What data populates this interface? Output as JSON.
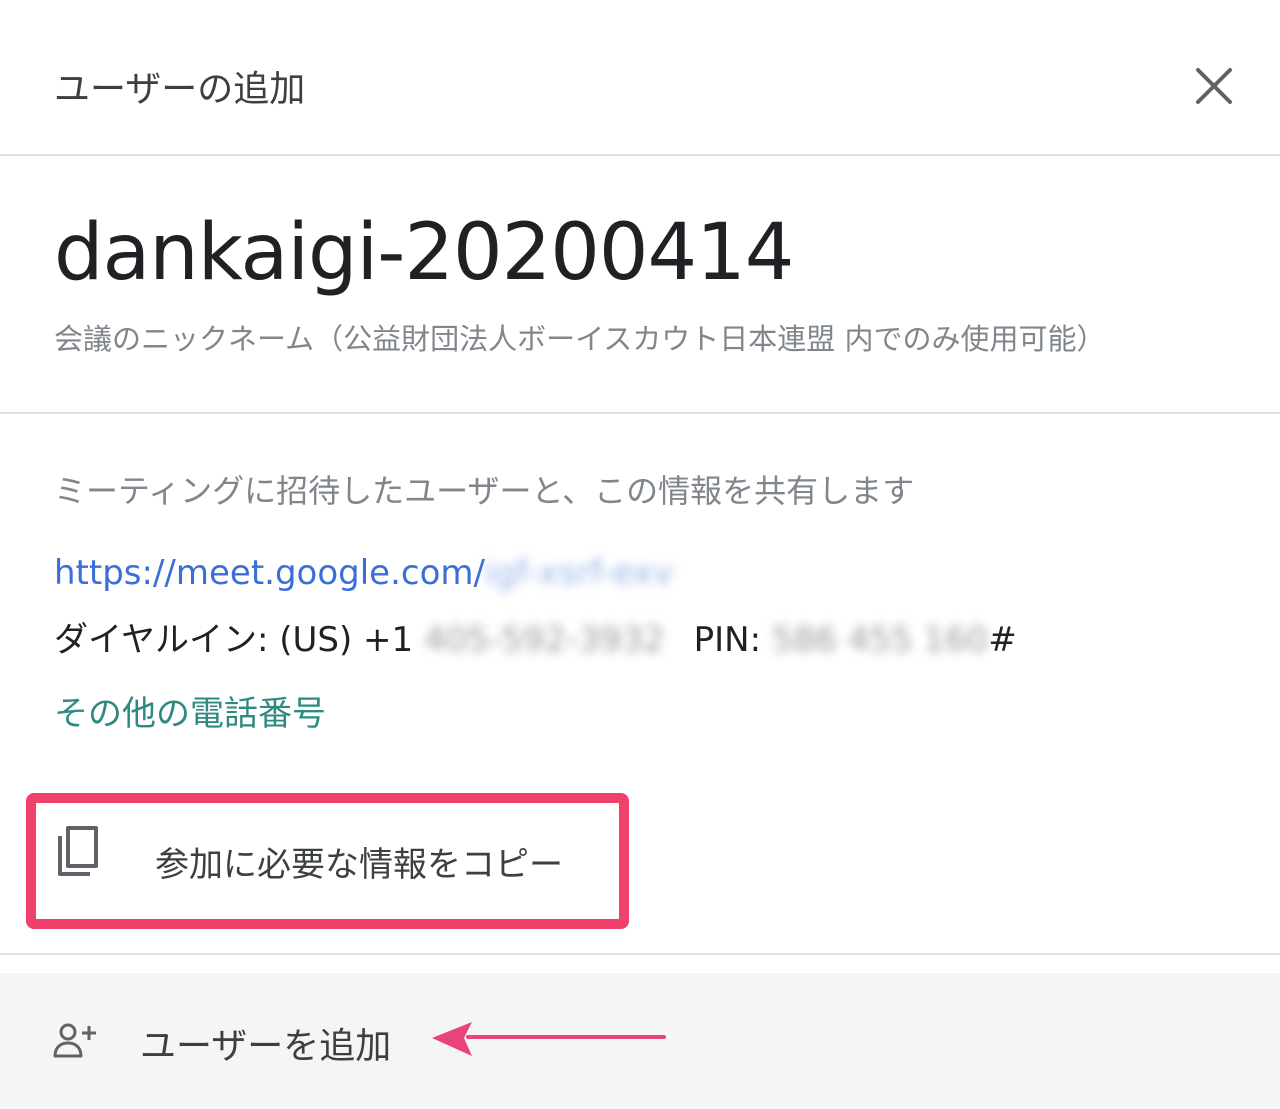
{
  "dialog": {
    "title": "ユーザーの追加",
    "close_icon": "close-icon"
  },
  "meeting": {
    "code": "dankaigi-20200414",
    "nickname_note": "会議のニックネーム（公益財団法人ボーイスカウト日本連盟 内でのみ使用可能）"
  },
  "info": {
    "share_description": "ミーティングに招待したユーザーと、この情報を共有します",
    "link_prefix": "https://meet.google.com/",
    "link_code_obscured": "igf-xsrf-exv",
    "dial_in_label": "ダイヤルイン: (US) +1",
    "dial_in_number_obscured": "405-592-3932",
    "pin_label": "PIN:",
    "pin_obscured": "586 455 160",
    "pin_suffix": "#",
    "more_phone_numbers": "その他の電話番号"
  },
  "actions": {
    "copy_label": "参加に必要な情報をコピー",
    "copy_icon": "copy-icon",
    "add_user_label": "ユーザーを追加",
    "add_user_icon": "person-add-icon"
  },
  "colors": {
    "highlight": "#f1406a",
    "link": "#3b6fd8",
    "secondary_link": "#2e8a80",
    "muted_text": "#80868b"
  }
}
